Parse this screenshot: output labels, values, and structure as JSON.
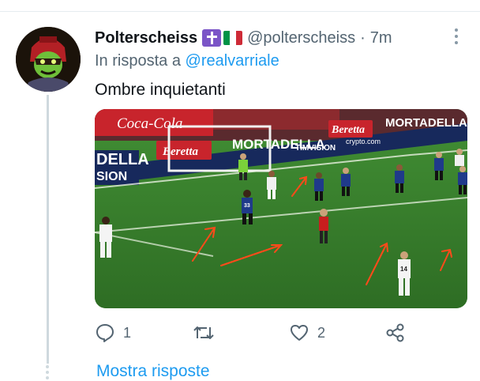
{
  "tweet": {
    "display_name": "Polterscheiss",
    "handle": "@polterscheiss",
    "separator": "·",
    "time": "7m",
    "reply_prefix": "In risposta a",
    "reply_mention": "@realvarriale",
    "text": "Ombre inquietanti",
    "media": {
      "ads": {
        "coca_cola": "Coca-Cola",
        "beretta": "Beretta",
        "mortadella": "MORTADELLA",
        "mortadella_left": "DELLA",
        "mission": "SION",
        "timvision": "TIMVISION",
        "crypto": "crypto.com"
      },
      "shirt_numbers": [
        "33",
        "14"
      ],
      "arrow_color": "#ff4a1a"
    },
    "actions": {
      "reply_count": "1",
      "retweet_count": "",
      "like_count": "2"
    },
    "show_replies": "Mostra risposte"
  },
  "colors": {
    "accent": "#1d9bf0",
    "secondary_text": "#536471",
    "flag": [
      "#009246",
      "#ffffff",
      "#ce2b37"
    ]
  },
  "icons": [
    "reply-icon",
    "retweet-icon",
    "like-icon",
    "share-icon",
    "more-options-icon"
  ]
}
